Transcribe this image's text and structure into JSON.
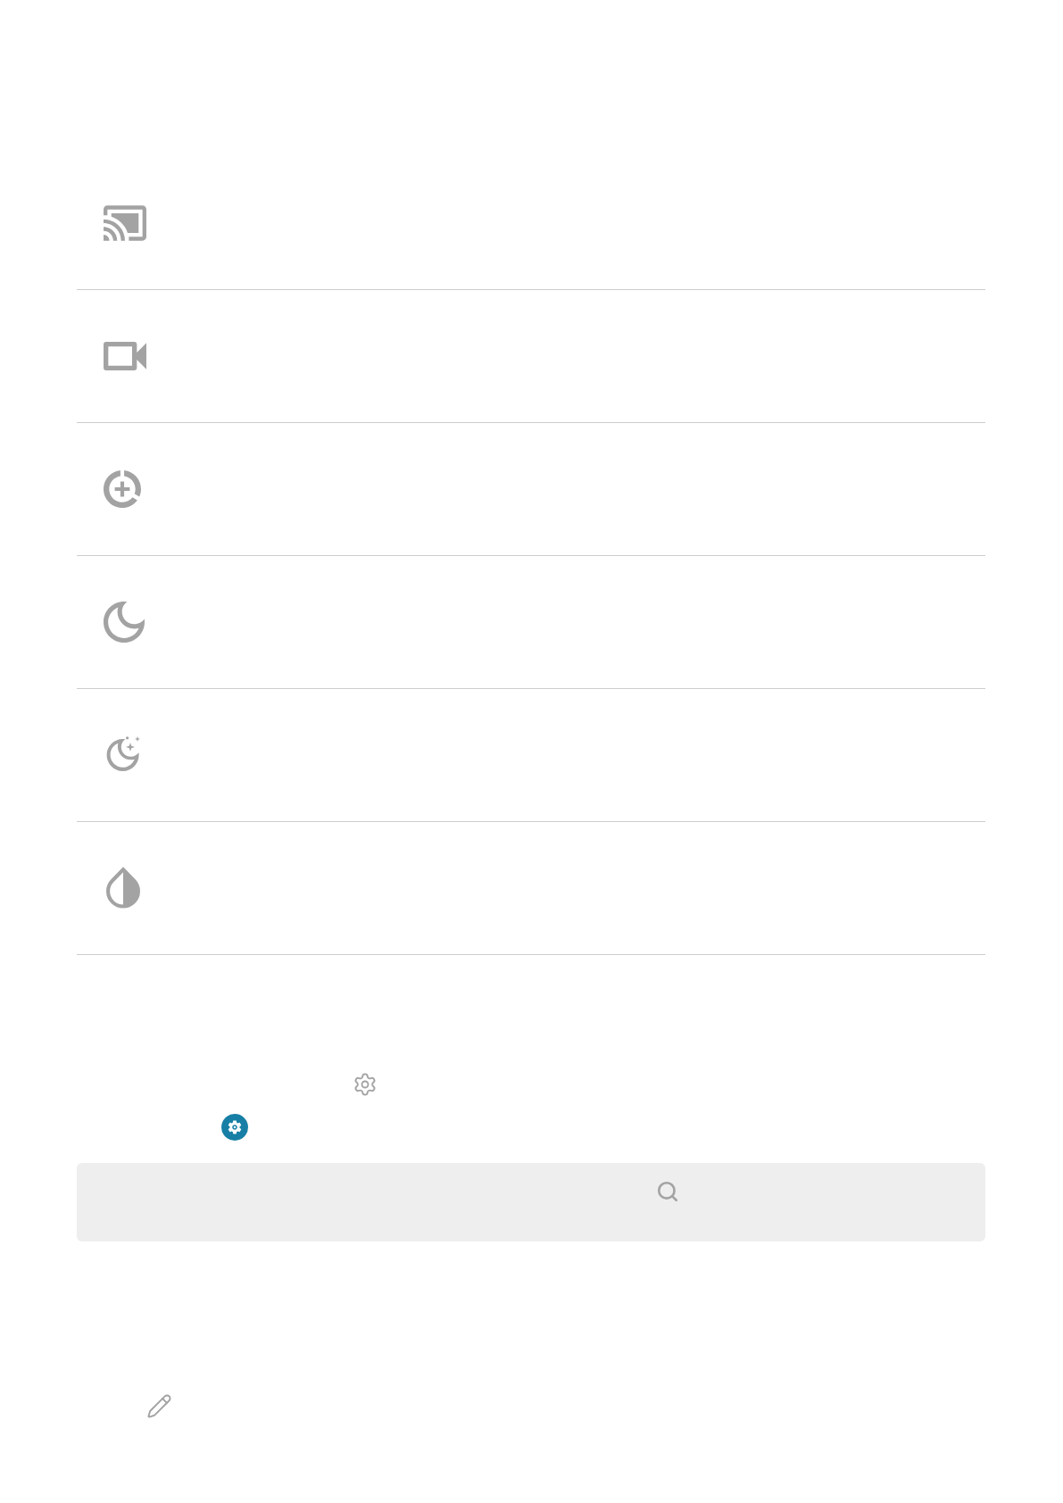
{
  "settings_table": {
    "rows": [
      {
        "kind": "cast"
      },
      {
        "kind": "video"
      },
      {
        "kind": "add_circle"
      },
      {
        "kind": "moon"
      },
      {
        "kind": "moon_stars"
      },
      {
        "kind": "contrast"
      }
    ]
  }
}
